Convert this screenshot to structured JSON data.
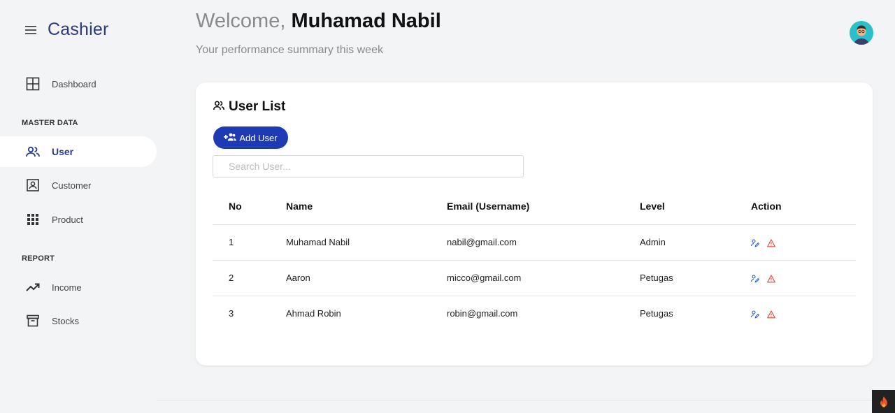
{
  "app": {
    "title": "Cashier"
  },
  "sidebar": {
    "items": [
      {
        "label": "Dashboard",
        "icon": "dashboard-icon"
      },
      {
        "label": "User",
        "icon": "users-icon",
        "active": true
      },
      {
        "label": "Customer",
        "icon": "contact-card-icon"
      },
      {
        "label": "Product",
        "icon": "grid-icon"
      },
      {
        "label": "Income",
        "icon": "trending-up-icon"
      },
      {
        "label": "Stocks",
        "icon": "archive-icon"
      }
    ],
    "sections": {
      "master_data": "MASTER DATA",
      "report": "REPORT"
    }
  },
  "header": {
    "greeting": "Welcome,",
    "user_name": "Muhamad Nabil",
    "subtitle": "Your performance summary this week"
  },
  "card": {
    "title": "User List",
    "add_button": "Add User",
    "search_placeholder": "Search User...",
    "columns": [
      "No",
      "Name",
      "Email (Username)",
      "Level",
      "Action"
    ],
    "rows": [
      {
        "no": "1",
        "name": "Muhamad Nabil",
        "email": "nabil@gmail.com",
        "level": "Admin"
      },
      {
        "no": "2",
        "name": "Aaron",
        "email": "micco@gmail.com",
        "level": "Petugas"
      },
      {
        "no": "3",
        "name": "Ahmad Robin",
        "email": "robin@gmail.com",
        "level": "Petugas"
      }
    ]
  },
  "colors": {
    "accent": "#1e3bb3",
    "brand_text": "#2a3a7c",
    "danger": "#e0443c",
    "avatar_bg": "#2bc0c9"
  }
}
